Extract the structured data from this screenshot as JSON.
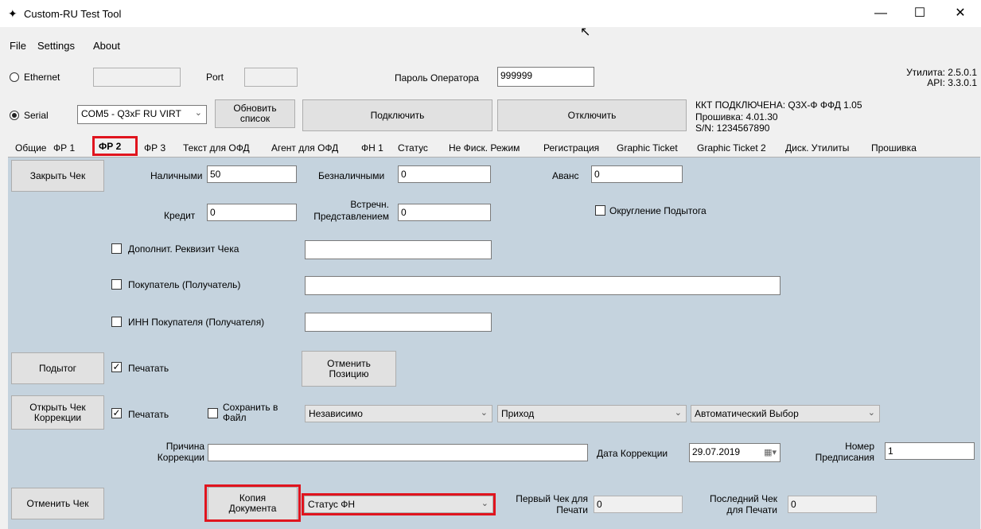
{
  "window": {
    "title": "Custom-RU Test Tool",
    "minimize": "—",
    "maximize": "☐",
    "close": "✕"
  },
  "menu": [
    "File",
    "Settings",
    "About"
  ],
  "conn": {
    "ethernet_label": "Ethernet",
    "port_label": "Port",
    "operator_password_label": "Пароль Оператора",
    "operator_password": "999999",
    "utility_version": "Утилита: 2.5.0.1",
    "api_version": "API: 3.3.0.1",
    "serial_label": "Serial",
    "com_port": "COM5 - Q3xF RU VIRT",
    "refresh_button": "Обновить список",
    "connect_button": "Подключить",
    "disconnect_button": "Отключить",
    "status_line1": "ККТ ПОДКЛЮЧЕНА: Q3X-Ф  ФФД 1.05",
    "status_line2": "Прошивка: 4.01.30",
    "status_line3": "S/N: 1234567890"
  },
  "tabs": [
    "Общие",
    "ФР 1",
    "ФР 2",
    "ФР 3",
    "Текст для ОФД",
    "Агент для ОФД",
    "ФН 1",
    "Статус",
    "Не Фиск. Режим",
    "Регистрация",
    "Graphic Ticket",
    "Graphic Ticket 2",
    "Диск. Утилиты",
    "Прошивка"
  ],
  "active_tab": "ФР 2",
  "form": {
    "close_check_button": "Закрыть Чек",
    "cash_label": "Наличными",
    "cash_value": "50",
    "cashless_label": "Безналичными",
    "cashless_value": "0",
    "advance_label": "Аванс",
    "advance_value": "0",
    "credit_label": "Кредит",
    "credit_value": "0",
    "counter_label_1": "Встречн.",
    "counter_label_2": "Представлением",
    "counter_value": "0",
    "rounding_label": "Округление Подытога",
    "extra_req_label": "Дополнит. Реквизит Чека",
    "buyer_label": "Покупатель (Получатель)",
    "buyer_inn_label": "ИНН Покупателя (Получателя)",
    "subtotal_button": "Подытог",
    "print_label": "Печатать",
    "cancel_position_button": "Отменить Позицию",
    "open_correction_button": "Открыть Чек Коррекции",
    "print_label_2": "Печатать",
    "save_to_file_label": "Сохранить в Файл",
    "correction_type": "Независимо",
    "correction_direction": "Приход",
    "tax_choice": "Автоматический Выбор",
    "reason_label_1": "Причина",
    "reason_label_2": "Коррекции",
    "correction_date_label": "Дата Коррекции",
    "correction_date": "29.07.2019",
    "order_number_label_1": "Номер",
    "order_number_label_2": "Предписания",
    "order_number": "1",
    "cancel_check_button": "Отменить Чек",
    "copy_document_button": "Копия Документа",
    "fn_status_select": "Статус ФН",
    "first_check_label_1": "Первый Чек для",
    "first_check_label_2": "Печати",
    "first_check_value": "0",
    "last_check_label_1": "Последний Чек",
    "last_check_label_2": "для Печати",
    "last_check_value": "0"
  }
}
